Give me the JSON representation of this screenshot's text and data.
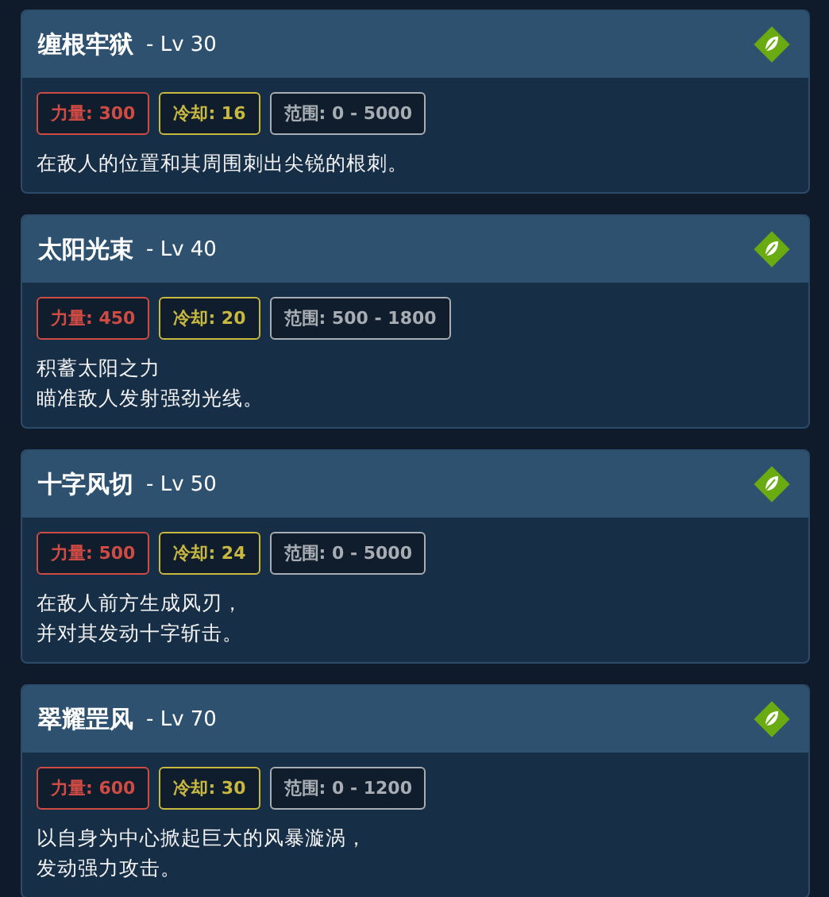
{
  "skills": [
    {
      "name": "缠根牢狱",
      "level": "- Lv 30",
      "stats": [
        {
          "kind": "power",
          "text": "力量: 300"
        },
        {
          "kind": "cooldown",
          "text": "冷却: 16"
        },
        {
          "kind": "range",
          "text": "范围: 0 - 5000"
        }
      ],
      "description": [
        "在敌人的位置和其周围刺出尖锐的根刺。"
      ]
    },
    {
      "name": "太阳光束",
      "level": "- Lv 40",
      "stats": [
        {
          "kind": "power",
          "text": "力量: 450"
        },
        {
          "kind": "cooldown",
          "text": "冷却: 20"
        },
        {
          "kind": "range",
          "text": "范围: 500 - 1800"
        }
      ],
      "description": [
        "积蓄太阳之力",
        "瞄准敌人发射强劲光线。"
      ]
    },
    {
      "name": "十字风切",
      "level": "- Lv 50",
      "stats": [
        {
          "kind": "power",
          "text": "力量: 500"
        },
        {
          "kind": "cooldown",
          "text": "冷却: 24"
        },
        {
          "kind": "range",
          "text": "范围: 0 - 5000"
        }
      ],
      "description": [
        "在敌人前方生成风刃，",
        "并对其发动十字斩击。"
      ]
    },
    {
      "name": "翠耀罡风",
      "level": "- Lv 70",
      "stats": [
        {
          "kind": "power",
          "text": "力量: 600"
        },
        {
          "kind": "cooldown",
          "text": "冷却: 30"
        },
        {
          "kind": "range",
          "text": "范围: 0 - 1200"
        }
      ],
      "description": [
        "以自身为中心掀起巨大的风暴漩涡，",
        "发动强力攻击。"
      ]
    }
  ]
}
